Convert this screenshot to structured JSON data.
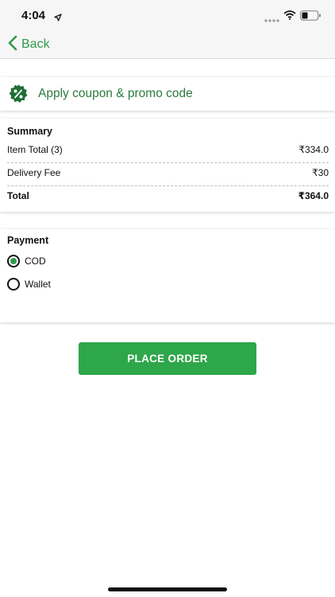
{
  "status_bar": {
    "time": "4:04",
    "icons": [
      "location-arrow-icon",
      "signal-icon",
      "wifi-icon",
      "battery-icon"
    ]
  },
  "nav": {
    "back_label": "Back",
    "back_icon": "chevron-left-icon"
  },
  "coupon": {
    "label": "Apply coupon & promo code",
    "icon": "percent-badge-icon"
  },
  "summary": {
    "title": "Summary",
    "rows": [
      {
        "label": "Item Total (3)",
        "value": "₹334.0"
      },
      {
        "label": "Delivery Fee",
        "value": "₹30"
      },
      {
        "label": "Total",
        "value": "₹364.0"
      }
    ]
  },
  "payment": {
    "title": "Payment",
    "options": [
      {
        "label": "COD",
        "selected": true
      },
      {
        "label": "Wallet",
        "selected": false
      }
    ]
  },
  "actions": {
    "place_order_label": "PLACE ORDER"
  },
  "colors": {
    "accent": "#2ea64a",
    "accent_text": "#2a7a3e",
    "background": "#ffffff",
    "bar_background": "#f6f6f6"
  }
}
